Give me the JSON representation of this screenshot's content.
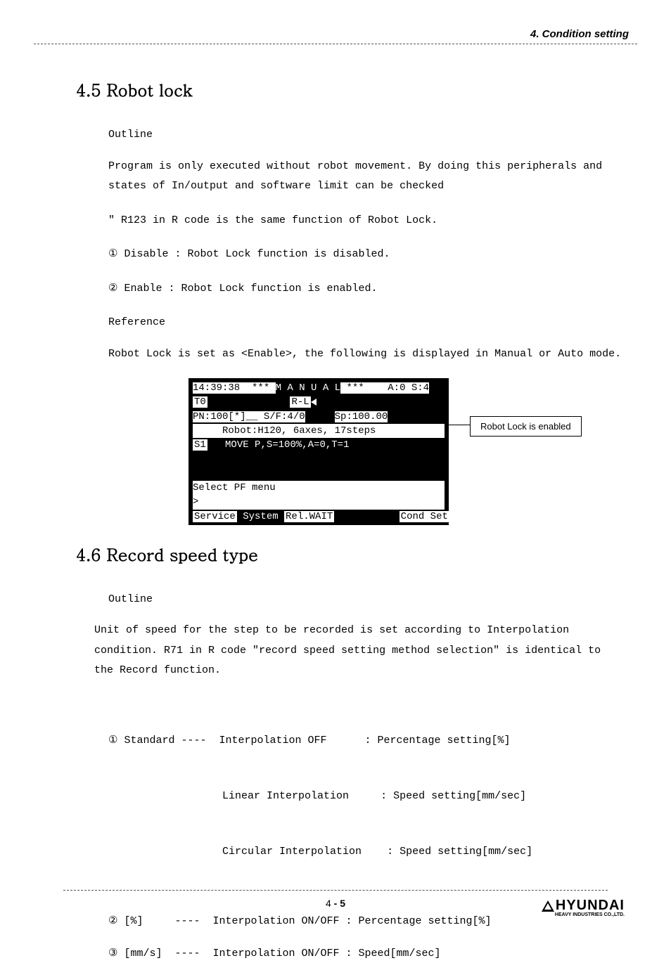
{
  "header": {
    "chapter": "4. Condition setting"
  },
  "s45": {
    "title": "4.5 Robot lock",
    "outline_label": "Outline",
    "para1": "Program is only executed without robot movement. By doing this peripherals and states of In/output and software limit can be checked",
    "para2": "\" R123 in R code is the same function of Robot Lock.",
    "opt1": "① Disable : Robot Lock function is disabled.",
    "opt2": "② Enable : Robot Lock function is enabled.",
    "reference_label": "Reference",
    "ref_text": " Robot Lock is set as <Enable>, the following is displayed in Manual or Auto mode."
  },
  "console": {
    "line1_left": "14:39:38  *** ",
    "line1_mid": "M A N U A L",
    "line1_right": " ***    ",
    "line1_end": "A:0 S:4",
    "line2_to": "T0",
    "line2_rl": "R-L",
    "line3_left": "PN:100[*]__ S/F:4/0",
    "line3_right": "Sp:100.00",
    "line4": "     Robot:H120, 6axes, 17steps",
    "line5_s1": "S1",
    "line5_cmd": "MOVE P,S=100%,A=0,T=1",
    "line6": "",
    "line7": "",
    "line8": "Select PF menu",
    "line9": ">",
    "line10_a": "Service",
    "line10_b": " System ",
    "line10_c": "Rel.WAIT",
    "line10_d": "Cond Set"
  },
  "callout": {
    "text": "Robot Lock is enabled"
  },
  "s46": {
    "title": "4.6 Record speed type",
    "outline_label": "Outline",
    "para1": "Unit of speed for the step to be recorded is set according to Interpolation condition.  R71 in R code \"record speed setting method selection\" is identical to the Record function.",
    "l1a": "① Standard ----  Interpolation OFF      : Percentage setting[%]",
    "l1b": "                  Linear Interpolation     : Speed setting[mm/sec]",
    "l1c": "                  Circular Interpolation    : Speed setting[mm/sec]",
    "l2": "② [%]     ----  Interpolation ON/OFF : Percentage setting[%]",
    "l3": "③ [mm/s]  ----  Interpolation ON/OFF : Speed[mm/sec]"
  },
  "footer": {
    "page_prefix": "4",
    "page_sep": " - ",
    "page_num": "5",
    "logo_main": "HYUNDAI",
    "logo_sub": "HEAVY INDUSTRIES CO.,LTD."
  }
}
